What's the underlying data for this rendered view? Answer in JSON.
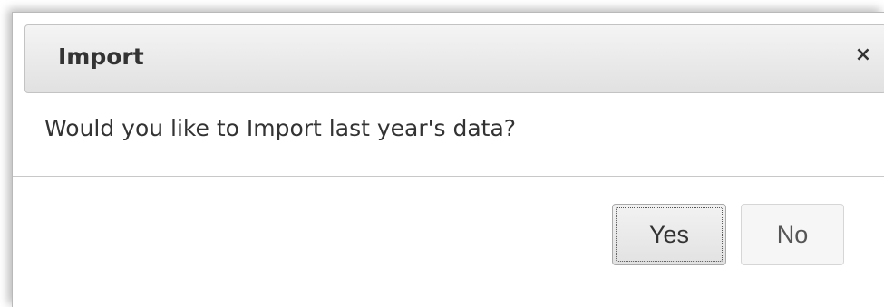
{
  "dialog": {
    "title": "Import",
    "close_icon": "close-icon",
    "close_glyph": "×",
    "message": "Would you like to Import last year's data?",
    "buttons": {
      "yes_label": "Yes",
      "no_label": "No"
    }
  },
  "colors": {
    "titlebar": "#e6e6e6",
    "text": "#333333",
    "border": "#c3c3c3"
  }
}
